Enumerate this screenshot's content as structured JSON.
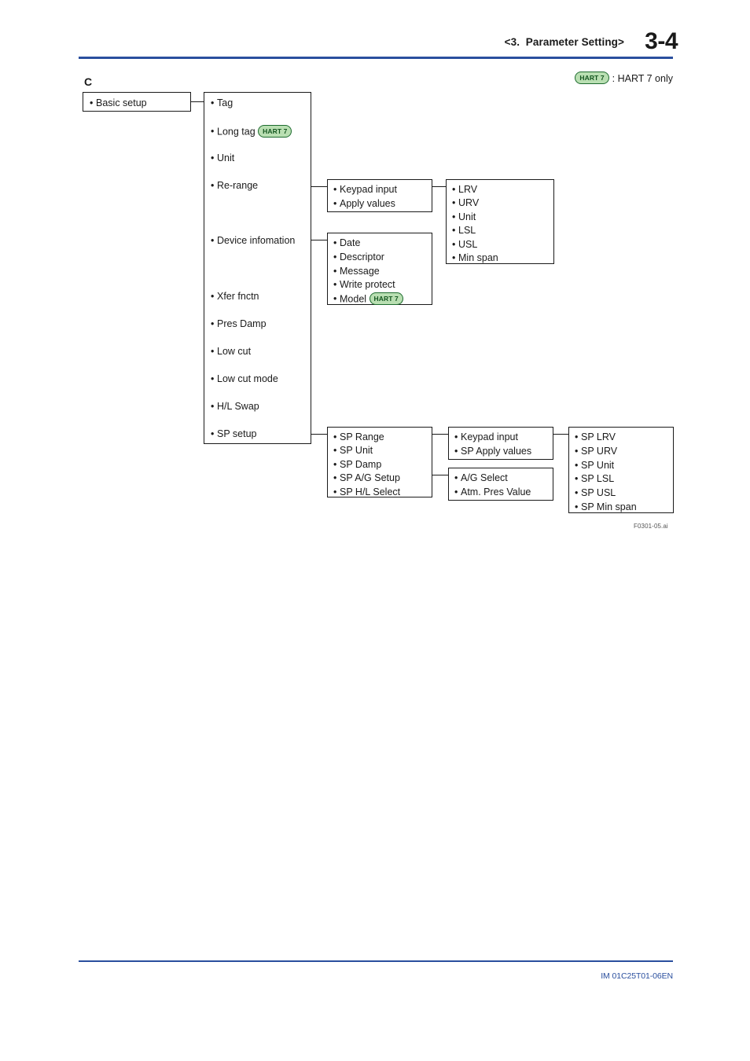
{
  "header": {
    "title": "<3.  Parameter Setting>",
    "page_number": "3-4"
  },
  "footer": {
    "document_code": "IM 01C25T01-06EN"
  },
  "diagram": {
    "section_letter": "C",
    "figure_caption": "F0301-05.ai",
    "legend": {
      "badge": "HART 7",
      "text": ": HART 7 only"
    },
    "badge_label": "HART 7",
    "colors": {
      "rule": "#2a4f9e",
      "badge_fill": "#b9dfb2",
      "badge_border": "#1d6b2e",
      "badge_text": "#13551f",
      "box_border": "#1a1a1a",
      "text": "#1a1a1a"
    },
    "boxes": {
      "basic_setup": {
        "items": [
          {
            "label": "Basic setup"
          }
        ]
      },
      "basic_setup_menu": {
        "items": [
          {
            "label": "Tag"
          },
          {
            "label": "Long tag",
            "badge": "HART 7"
          },
          {
            "label": "Unit"
          },
          {
            "label": "Re-range"
          },
          {
            "label": "Device infomation"
          },
          {
            "label": "Xfer fnctn"
          },
          {
            "label": "Pres Damp"
          },
          {
            "label": "Low cut"
          },
          {
            "label": "Low cut mode"
          },
          {
            "label": "H/L Swap"
          },
          {
            "label": "SP setup"
          }
        ]
      },
      "re_range": {
        "items": [
          {
            "label": "Keypad input"
          },
          {
            "label": "Apply values"
          }
        ]
      },
      "re_range_values": {
        "items": [
          {
            "label": "LRV"
          },
          {
            "label": "URV"
          },
          {
            "label": "Unit"
          },
          {
            "label": "LSL"
          },
          {
            "label": "USL"
          },
          {
            "label": "Min span"
          }
        ]
      },
      "device_information": {
        "items": [
          {
            "label": "Date"
          },
          {
            "label": "Descriptor"
          },
          {
            "label": "Message"
          },
          {
            "label": "Write protect"
          },
          {
            "label": "Model",
            "badge": "HART 7"
          }
        ]
      },
      "sp_setup": {
        "items": [
          {
            "label": "SP Range"
          },
          {
            "label": "SP Unit"
          },
          {
            "label": "SP Damp"
          },
          {
            "label": "SP A/G Setup"
          },
          {
            "label": "SP H/L Select"
          }
        ]
      },
      "sp_range": {
        "items": [
          {
            "label": "Keypad input"
          },
          {
            "label": "SP Apply values"
          }
        ]
      },
      "sp_ag_setup": {
        "items": [
          {
            "label": "A/G Select"
          },
          {
            "label": "Atm. Pres Value"
          }
        ]
      },
      "sp_range_values": {
        "items": [
          {
            "label": "SP LRV"
          },
          {
            "label": "SP URV"
          },
          {
            "label": "SP Unit"
          },
          {
            "label": "SP LSL"
          },
          {
            "label": "SP USL"
          },
          {
            "label": "SP Min span"
          }
        ]
      }
    }
  }
}
